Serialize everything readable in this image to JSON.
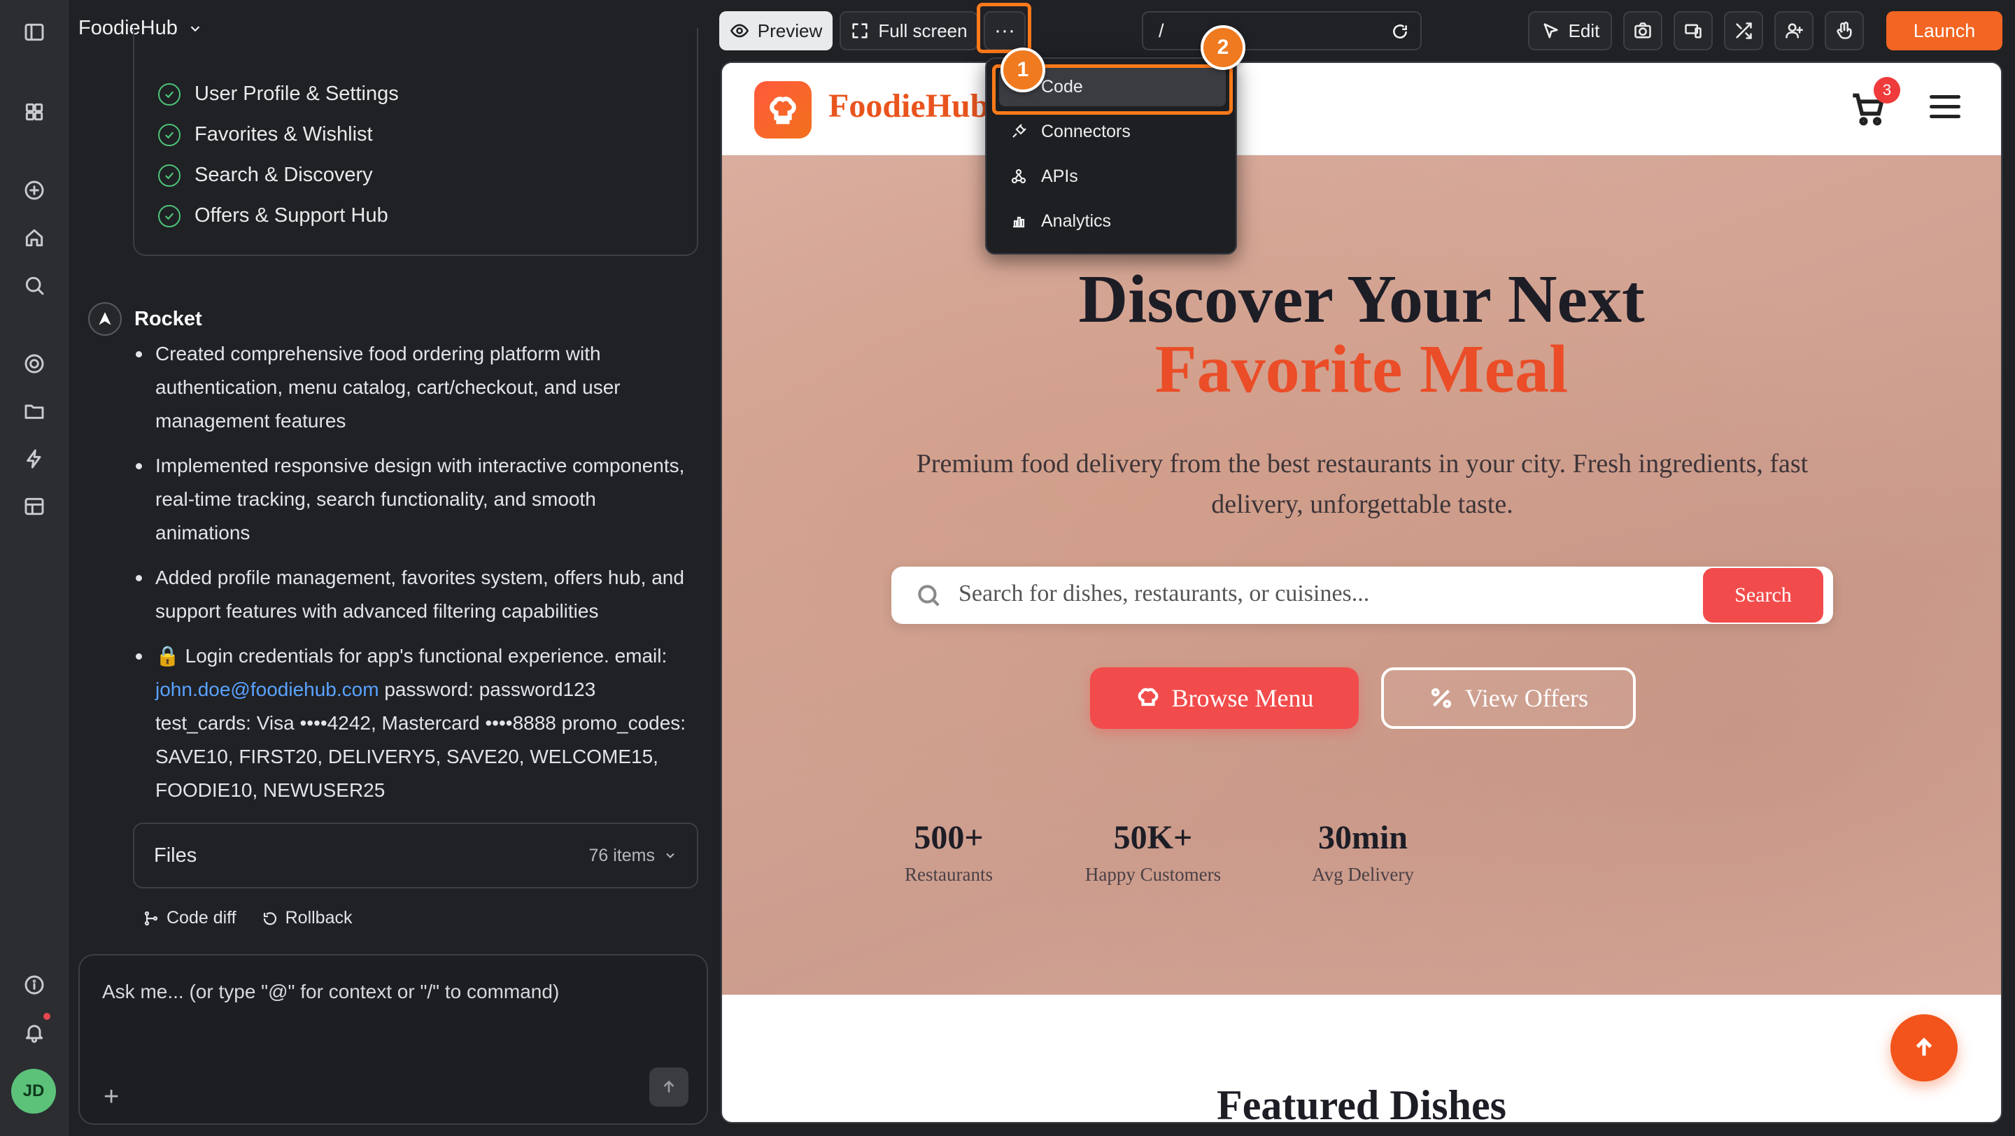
{
  "project": {
    "name": "FoodieHub"
  },
  "features": [
    "User Profile & Settings",
    "Favorites & Wishlist",
    "Search & Discovery",
    "Offers & Support Hub"
  ],
  "assistant": {
    "name": "Rocket",
    "bullets": [
      "Created comprehensive food ordering platform with authentication, menu catalog, cart/checkout, and user management features",
      "Implemented responsive design with interactive components, real-time tracking, search functionality, and smooth animations",
      "Added profile management, favorites system, offers hub, and support features with advanced filtering capabilities"
    ],
    "credentials_prefix": "🔒 Login credentials for app's functional experience. email:",
    "email": "john.doe@foodiehub.com",
    "credentials_rest": " password: password123 test_cards: Visa ••••4242, Mastercard ••••8888 promo_codes: SAVE10, FIRST20, DELIVERY5, SAVE20, WELCOME15, FOODIE10, NEWUSER25"
  },
  "files": {
    "label": "Files",
    "count": "76 items"
  },
  "actions": {
    "code_diff": "Code diff",
    "rollback": "Rollback"
  },
  "composer": {
    "placeholder": "Ask me... (or type \"@\" for context or \"/\" to command)"
  },
  "toolbar": {
    "preview": "Preview",
    "fullscreen": "Full screen",
    "more": "···",
    "url": "/",
    "edit": "Edit",
    "launch": "Launch"
  },
  "menu": {
    "items": [
      "Code",
      "Connectors",
      "APIs",
      "Analytics"
    ]
  },
  "annotations": {
    "step1": "1",
    "step2": "2"
  },
  "site": {
    "logo": "FoodieHub",
    "cart_count": "3",
    "hero_line1": "Discover Your Next",
    "hero_line2": "Favorite Meal",
    "subtitle": "Premium food delivery from the best restaurants in your city. Fresh ingredients, fast delivery, unforgettable taste.",
    "search_placeholder": "Search for dishes, restaurants, or cuisines...",
    "search_button": "Search",
    "browse": "Browse Menu",
    "offers": "View Offers",
    "stats": [
      {
        "value": "500+",
        "label": "Restaurants"
      },
      {
        "value": "50K+",
        "label": "Happy Customers"
      },
      {
        "value": "30min",
        "label": "Avg Delivery"
      }
    ],
    "featured": "Featured Dishes"
  },
  "user": {
    "initials": "JD"
  },
  "colors": {
    "accent": "#f26522",
    "highlight": "#ff7a1a",
    "brand": "#e9541e",
    "cta": "#f24b4b"
  }
}
